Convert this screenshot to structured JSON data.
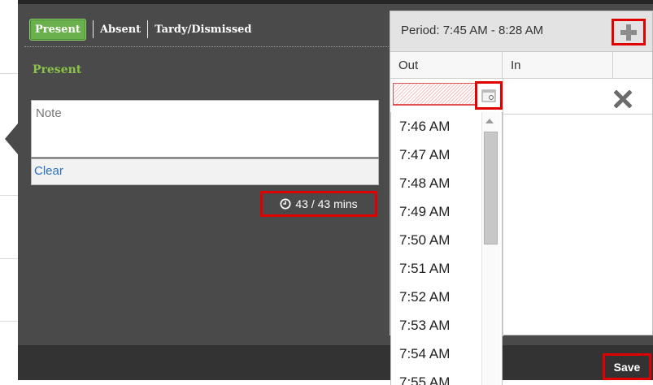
{
  "tabs": {
    "present": "Present",
    "absent": "Absent",
    "tardy_dismissed": "Tardy/Dismissed"
  },
  "status_label": "Present",
  "note": {
    "placeholder": "Note",
    "value": ""
  },
  "clear_label": "Clear",
  "minutes_text": "43 / 43 mins",
  "period": {
    "title": "Period: 7:45 AM - 8:28 AM",
    "columns": [
      "Out",
      "In"
    ],
    "row": {
      "out_value": "",
      "in_value": ""
    }
  },
  "time_options": [
    "7:46 AM",
    "7:47 AM",
    "7:48 AM",
    "7:49 AM",
    "7:50 AM",
    "7:51 AM",
    "7:52 AM",
    "7:53 AM",
    "7:54 AM",
    "7:55 AM"
  ],
  "save_label": "Save",
  "icons": {
    "add": "plus-icon",
    "delete": "close-icon",
    "picker": "time-picker-icon",
    "clock": "clock-icon"
  },
  "colors": {
    "present_green": "#6ab04c",
    "status_green": "#8bc34a",
    "highlight_red": "#e00000",
    "panel_bg": "#4a4a4a",
    "link_blue": "#2a6fc0"
  }
}
